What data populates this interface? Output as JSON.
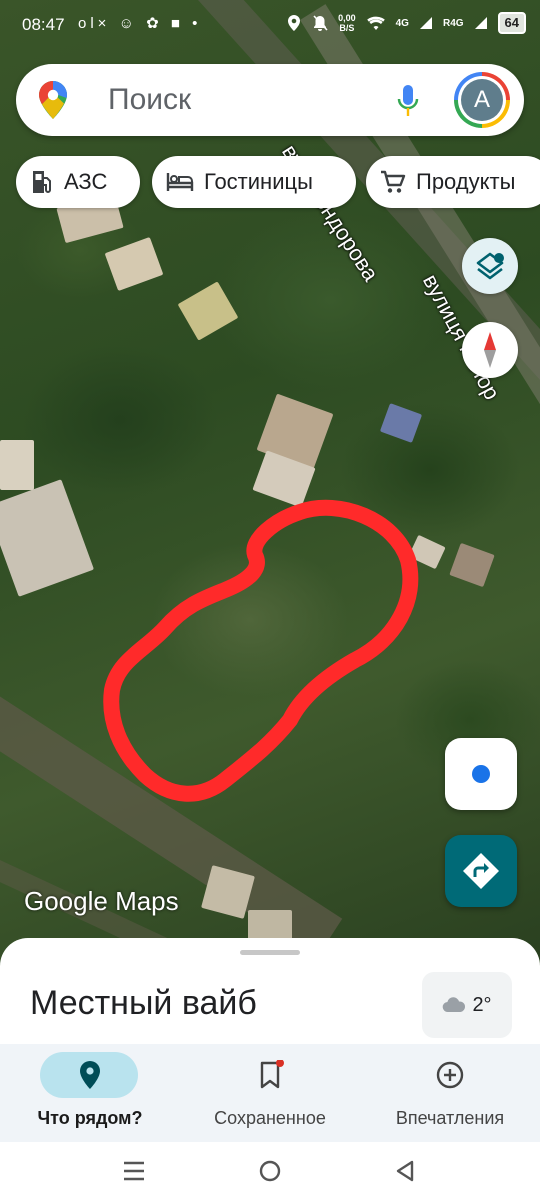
{
  "status_bar": {
    "time": "08:47",
    "left_icons": [
      "olx-icon",
      "smiley-icon",
      "bug-icon",
      "square-icon",
      "dot-icon"
    ],
    "speed_value": "0,00",
    "speed_unit": "B/S",
    "network_1": "4G",
    "network_2": "R4G",
    "battery": "64"
  },
  "search": {
    "placeholder": "Поиск",
    "avatar_letter": "A"
  },
  "chips": [
    {
      "label": "АЗС",
      "icon": "gas-station-icon"
    },
    {
      "label": "Гостиницы",
      "icon": "bed-icon"
    },
    {
      "label": "Продукты",
      "icon": "cart-icon"
    }
  ],
  "map": {
    "street_label_1": "вул. Кондорова",
    "street_label_2": "вулиця Мілор",
    "watermark": "Google Maps",
    "colors": {
      "scribble": "#ff2a2a",
      "accent": "#006a77"
    }
  },
  "sheet": {
    "title": "Местный вайб",
    "weather_temp": "2°"
  },
  "bottom_nav": {
    "items": [
      {
        "label": "Что рядом?",
        "icon": "location-pin-icon",
        "active": true
      },
      {
        "label": "Сохраненное",
        "icon": "bookmark-icon",
        "active": false
      },
      {
        "label": "Впечатления",
        "icon": "add-circle-icon",
        "active": false
      }
    ]
  }
}
